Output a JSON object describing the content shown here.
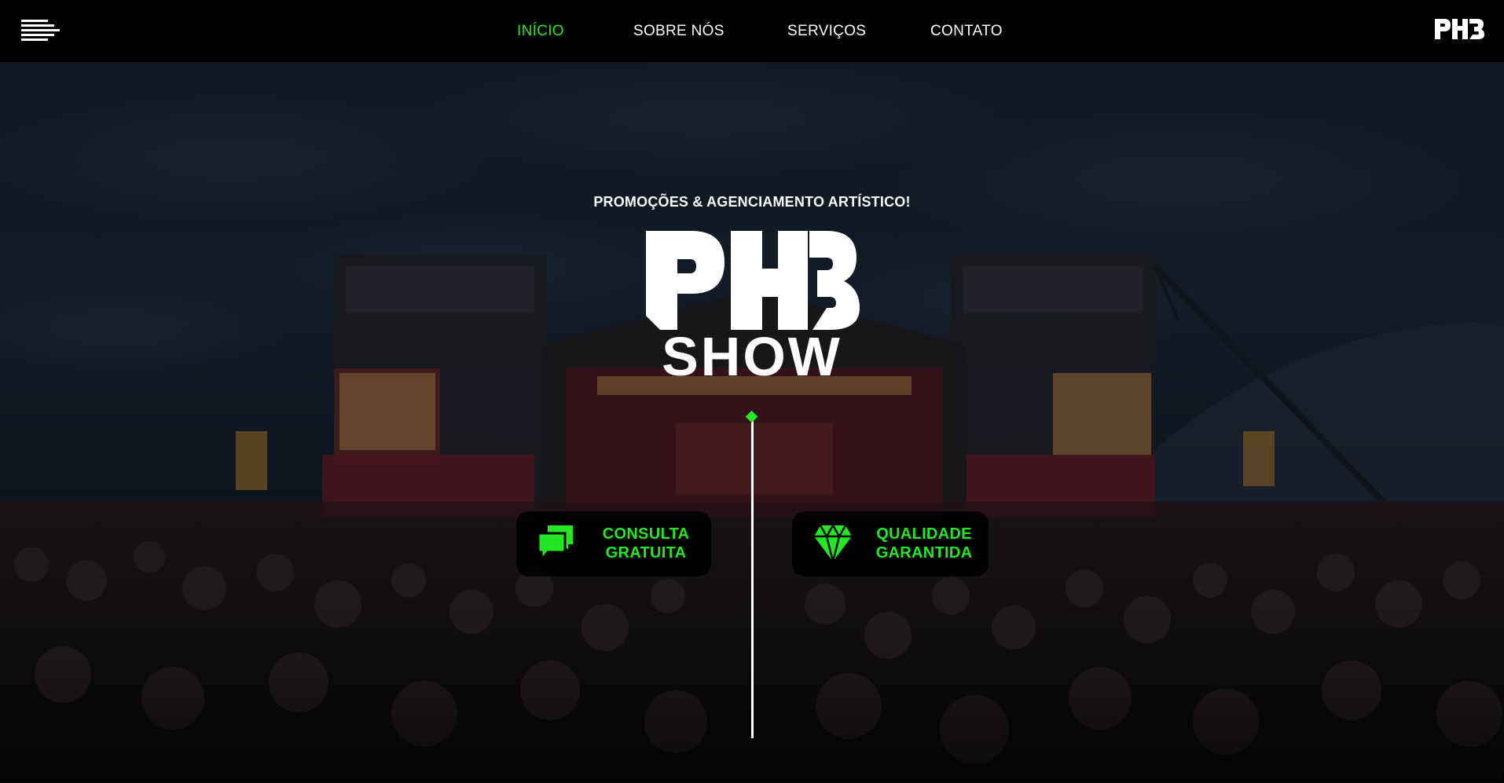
{
  "nav": {
    "menu_icon": "hamburger-menu-icon",
    "links": [
      {
        "label": "INÍCIO",
        "active": true
      },
      {
        "label": "SOBRE NÓS",
        "active": false
      },
      {
        "label": "SERVIÇOS",
        "active": false
      },
      {
        "label": "CONTATO",
        "active": false
      }
    ],
    "logo": "PHB"
  },
  "hero": {
    "tagline": "PROMOÇÕES & AGENCIAMENTO ARTÍSTICO!",
    "logo": {
      "top": "PHB",
      "bottom": "SHOW"
    },
    "features": [
      {
        "icon": "chat-bubbles-icon",
        "line1": "CONSULTA",
        "line2": "GRATUITA"
      },
      {
        "icon": "diamond-icon",
        "line1": "QUALIDADE",
        "line2": "GARANTIDA"
      }
    ]
  },
  "colors": {
    "accent": "#22e722",
    "nav_bg": "#000000",
    "text": "#ffffff"
  }
}
